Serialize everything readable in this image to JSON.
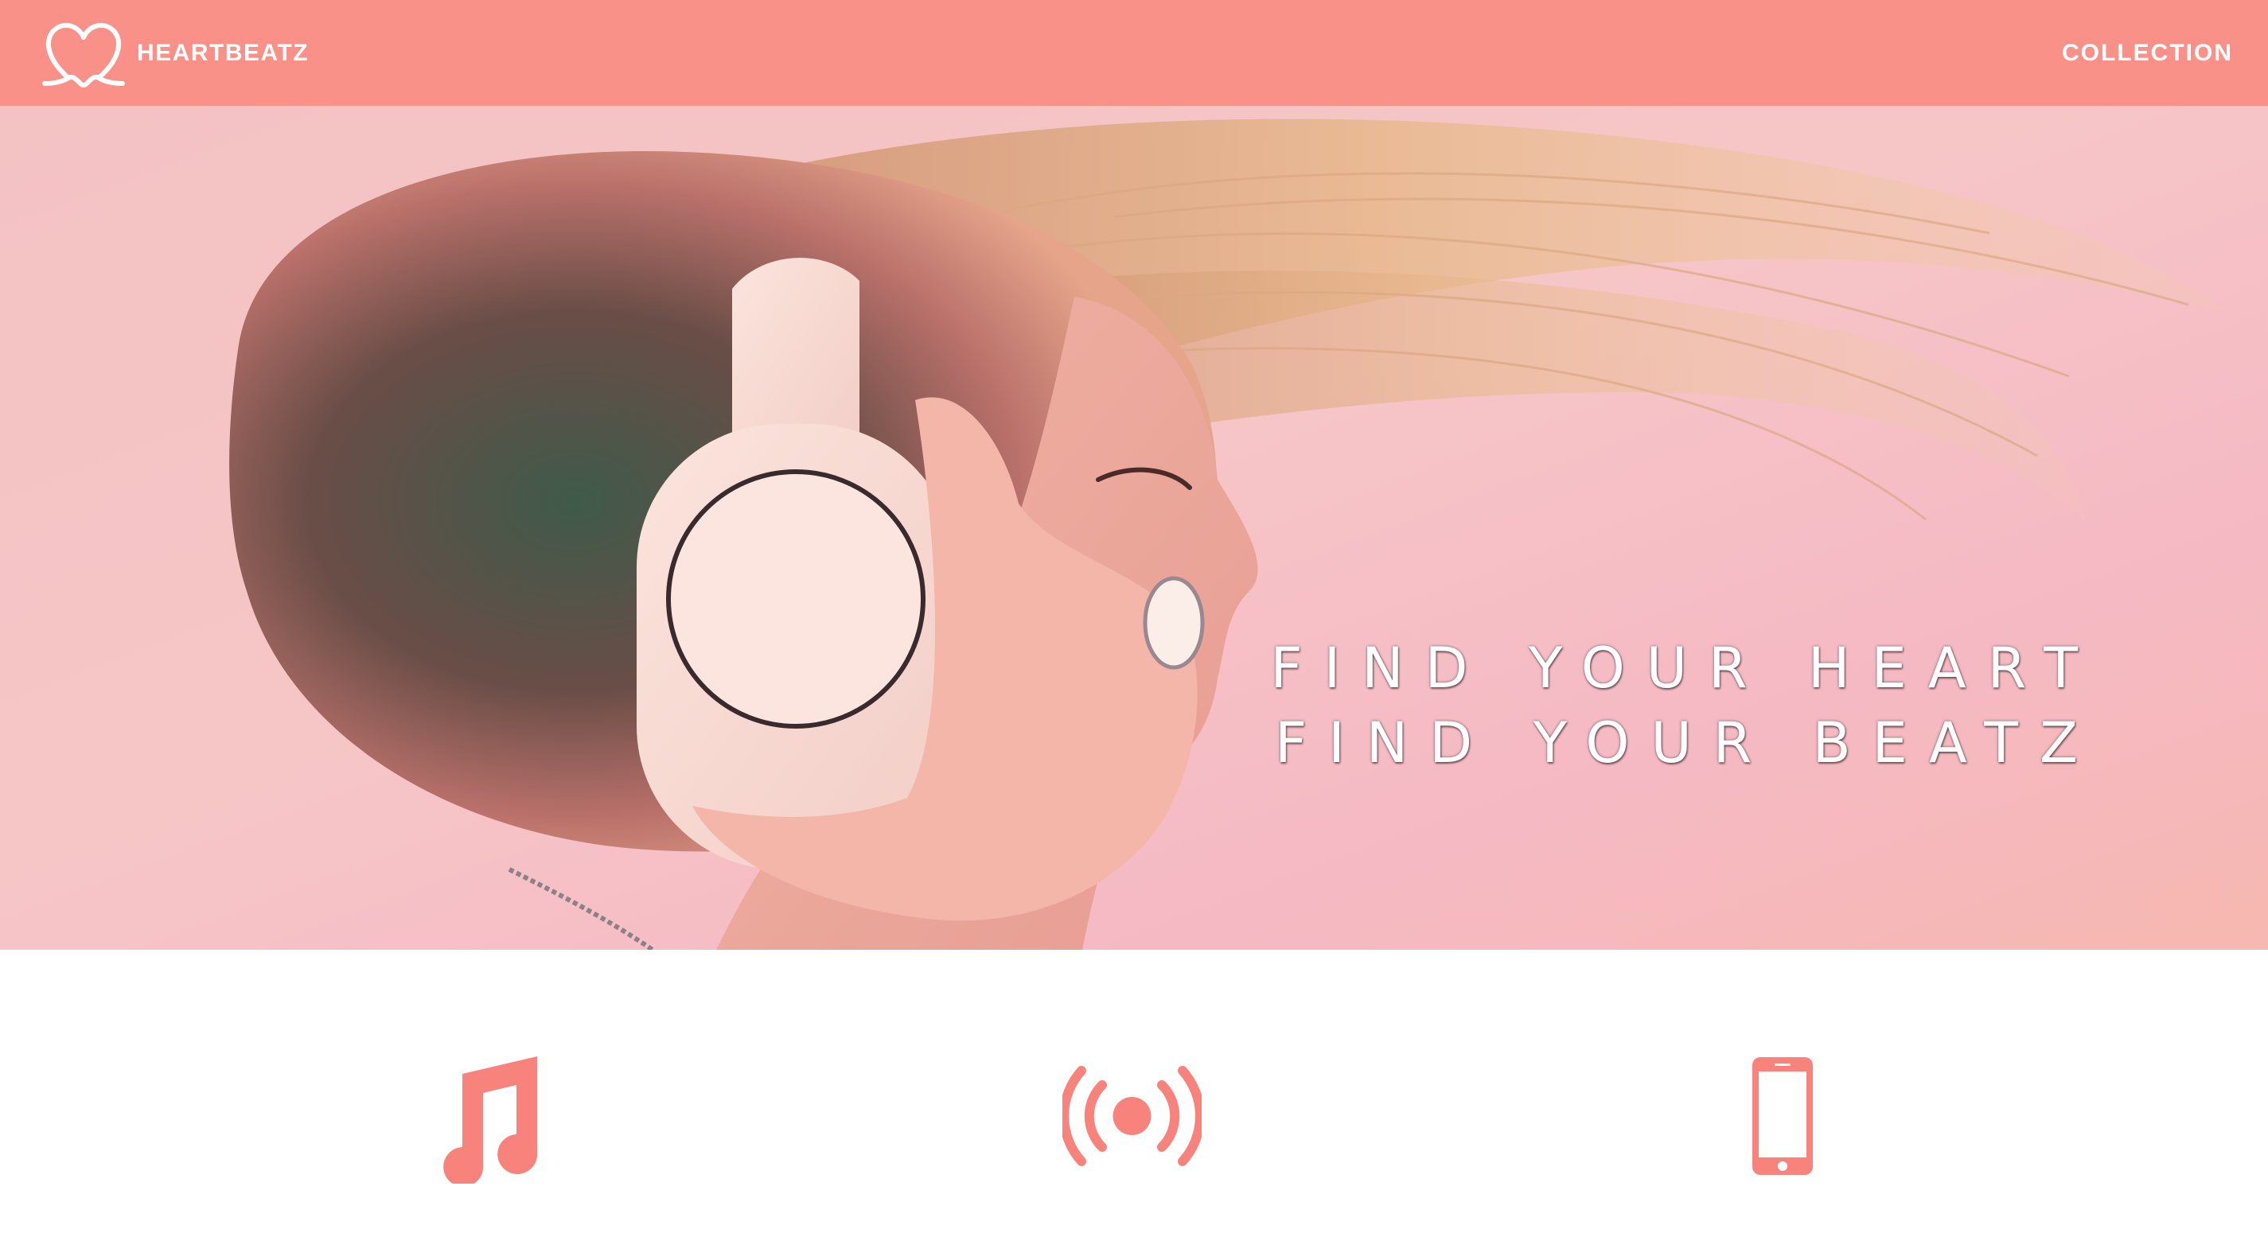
{
  "brand": {
    "name": "HEARTBEATZ",
    "logo_icon": "heart-outline-icon"
  },
  "nav": {
    "links": [
      {
        "label": "COLLECTION"
      }
    ]
  },
  "hero": {
    "tagline": [
      "FIND YOUR HEART",
      "FIND YOUR BEATZ"
    ],
    "image_subject": "woman wearing headphones with windblown hair"
  },
  "features": {
    "icons": [
      "music-note-icon",
      "broadcast-icon",
      "smartphone-icon"
    ]
  },
  "colors": {
    "accent": "#fa9189",
    "nav_text": "#ffffff",
    "hero_text": "#ffffff",
    "background": "#ffffff"
  }
}
